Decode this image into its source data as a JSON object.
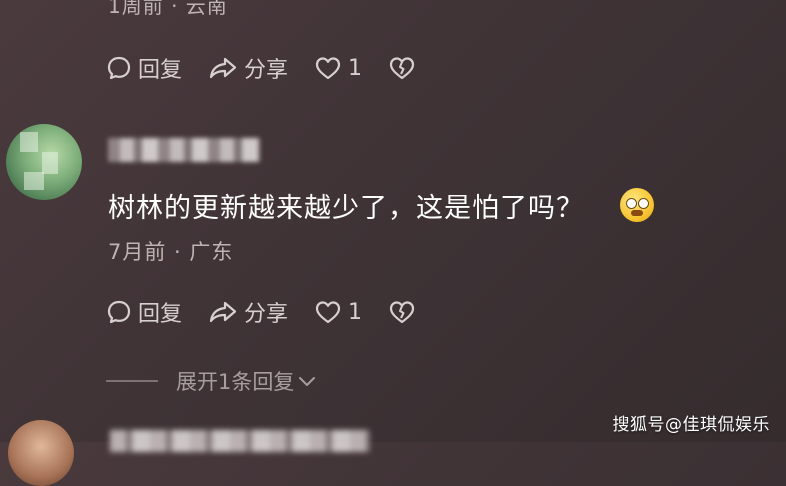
{
  "top_comment": {
    "meta": "1周前 · 云南"
  },
  "action_bar_1": {
    "reply_label": "回复",
    "share_label": "分享",
    "like_count": "1"
  },
  "comment": {
    "text": "树林的更新越来越少了，这是怕了吗？",
    "meta": "7月前 · 广东"
  },
  "action_bar_2": {
    "reply_label": "回复",
    "share_label": "分享",
    "like_count": "1"
  },
  "expand": {
    "label": "展开1条回复"
  },
  "watermark": "搜狐号@佳琪侃娱乐",
  "icons": [
    "comment-bubble-icon",
    "share-arrow-icon",
    "heart-icon",
    "broken-heart-icon",
    "chevron-down-icon"
  ],
  "colors": {
    "background": "#3f3336",
    "text": "#ffffff",
    "meta": "#bfb4b4"
  }
}
